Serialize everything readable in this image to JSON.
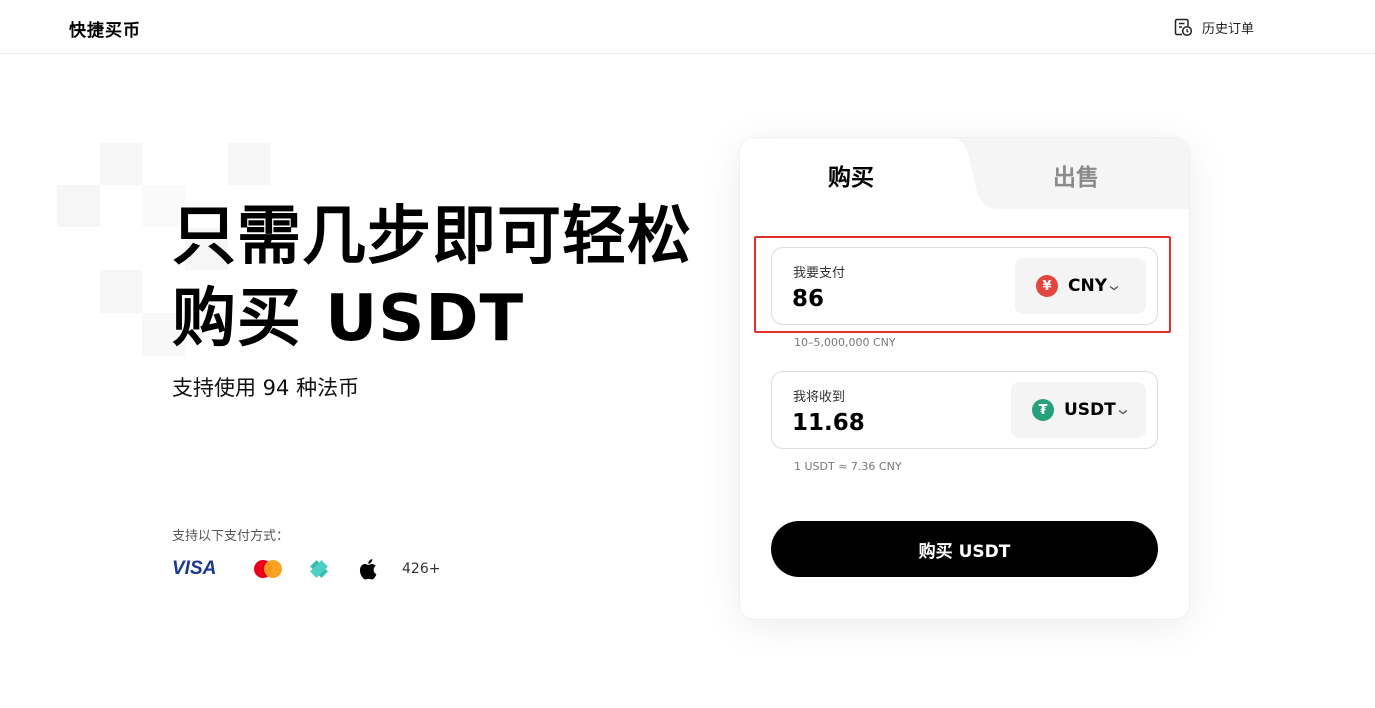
{
  "header": {
    "brand": "快捷买币",
    "history_label": "历史订单"
  },
  "hero": {
    "title_line1": "只需几步即可轻松",
    "title_line2": "购买 USDT",
    "subtitle": "支持使用 94 种法币",
    "payment_methods_label": "支持以下支付方式：",
    "payment_methods": [
      "VISA",
      "mastercard",
      "pix",
      "apple-pay"
    ],
    "visa_text": "VISA",
    "more_methods": "426+"
  },
  "trade_card": {
    "tabs": [
      {
        "label": "购买",
        "active": true
      },
      {
        "label": "出售",
        "active": false
      }
    ],
    "pay": {
      "label": "我要支付",
      "amount": "86",
      "currency": "CNY",
      "currency_symbol": "¥",
      "currency_color": "#e2463f",
      "range_hint": "10–5,000,000 CNY"
    },
    "receive": {
      "label": "我将收到",
      "amount": "11.68",
      "currency": "USDT",
      "currency_symbol": "₮",
      "currency_color": "#26a17b",
      "rate_hint": "1 USDT ≈ 7.36 CNY"
    },
    "submit_label": "购买 USDT",
    "highlight_color": "#e0302a"
  }
}
